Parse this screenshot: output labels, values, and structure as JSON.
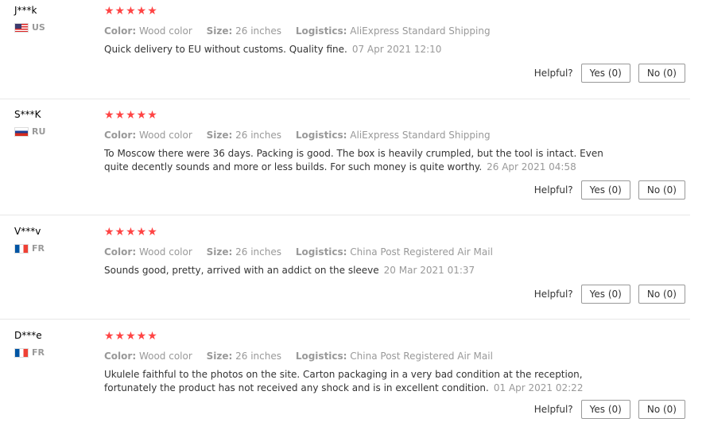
{
  "labels": {
    "color": "Color:",
    "size": "Size:",
    "logistics": "Logistics:",
    "helpful": "Helpful?"
  },
  "reviews": [
    {
      "user": "J***k",
      "country": "US",
      "flag": "us",
      "stars": "★★★★★",
      "color": "Wood color",
      "size": "26 inches",
      "logistics": "AliExpress Standard Shipping",
      "text": "Quick delivery to EU without customs. Quality fine.",
      "date": "07 Apr 2021 12:10",
      "yes": "Yes (0)",
      "no": "No (0)"
    },
    {
      "user": "S***K",
      "country": "RU",
      "flag": "ru",
      "stars": "★★★★★",
      "color": "Wood color",
      "size": "26 inches",
      "logistics": "AliExpress Standard Shipping",
      "text": "To Moscow there were 36 days. Packing is good. The box is heavily crumpled, but the tool is intact. Even quite decently sounds and more or less builds. For such money is quite worthy.",
      "date": "26 Apr 2021 04:58",
      "yes": "Yes (0)",
      "no": "No (0)"
    },
    {
      "user": "V***v",
      "country": "FR",
      "flag": "fr",
      "stars": "★★★★★",
      "color": "Wood color",
      "size": "26 inches",
      "logistics": "China Post Registered Air Mail",
      "text": "Sounds good, pretty, arrived with an addict on the sleeve",
      "date": "20 Mar 2021 01:37",
      "yes": "Yes (0)",
      "no": "No (0)"
    },
    {
      "user": "D***e",
      "country": "FR",
      "flag": "fr",
      "stars": "★★★★★",
      "color": "Wood color",
      "size": "26 inches",
      "logistics": "China Post Registered Air Mail",
      "text": "Ukulele faithful to the photos on the site. Carton packaging in a very bad condition at the reception, fortunately the product has not received any shock and is in excellent condition.",
      "date": "01 Apr 2021 02:22",
      "yes": "Yes (0)",
      "no": "No (0)"
    }
  ]
}
